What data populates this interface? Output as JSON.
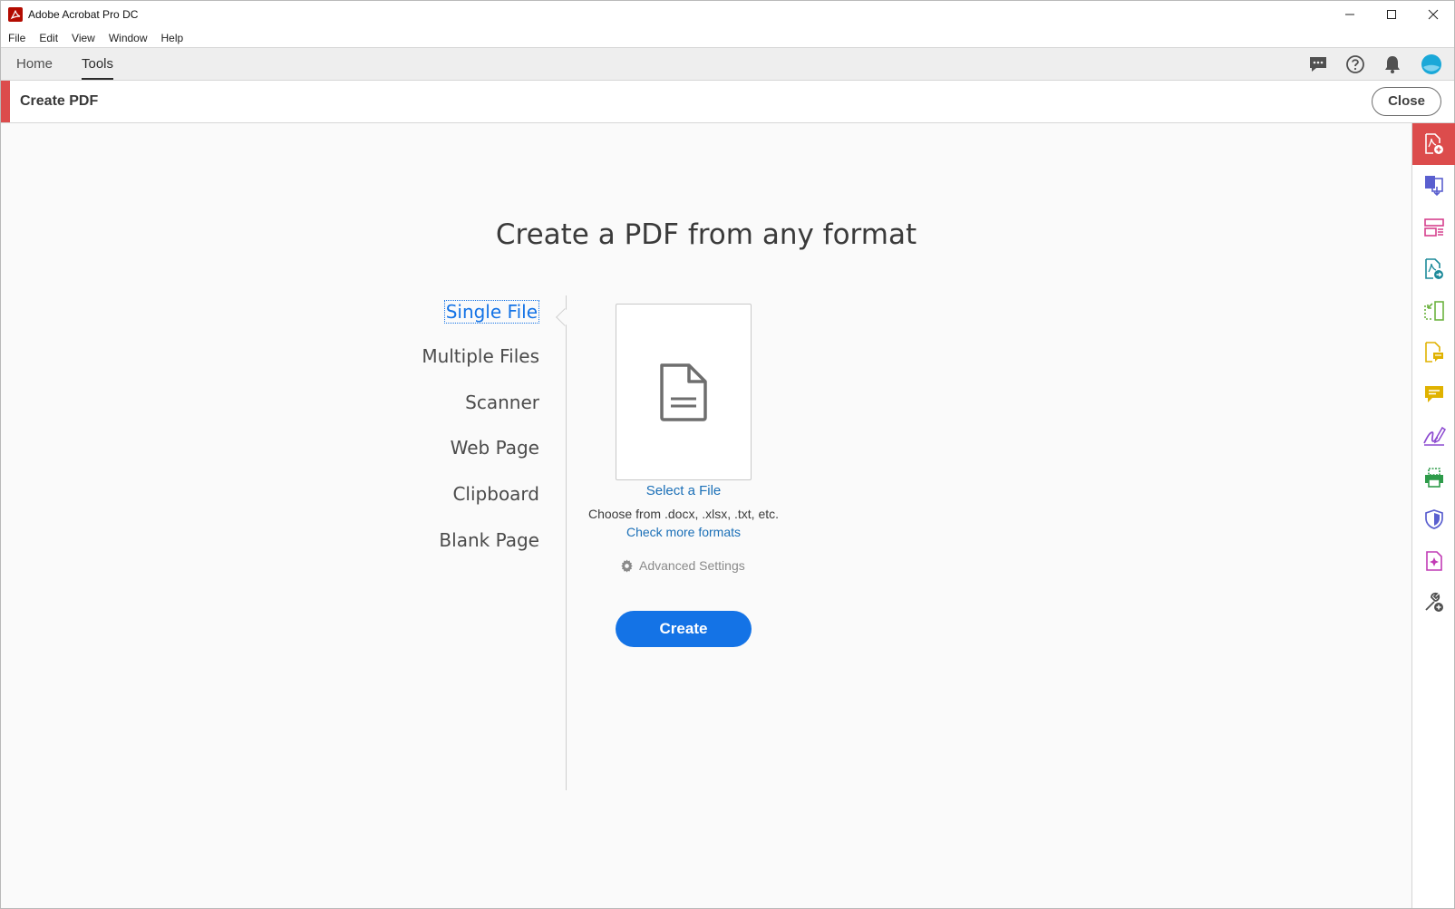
{
  "window": {
    "title": "Adobe Acrobat Pro DC",
    "controls": [
      "minimize-icon",
      "maximize-icon",
      "close-icon"
    ]
  },
  "menubar": {
    "items": [
      "File",
      "Edit",
      "View",
      "Window",
      "Help"
    ]
  },
  "tabs": {
    "items": [
      {
        "label": "Home",
        "active": false
      },
      {
        "label": "Tools",
        "active": true
      }
    ],
    "right_icons": [
      "chat-icon",
      "help-icon",
      "bell-icon",
      "avatar-icon"
    ]
  },
  "tool_header": {
    "title": "Create PDF",
    "close_label": "Close",
    "accent_color": "#dc4c4c"
  },
  "main": {
    "headline": "Create a PDF from any format",
    "options": [
      {
        "label": "Single File",
        "active": true
      },
      {
        "label": "Multiple Files",
        "active": false
      },
      {
        "label": "Scanner",
        "active": false
      },
      {
        "label": "Web Page",
        "active": false
      },
      {
        "label": "Clipboard",
        "active": false
      },
      {
        "label": "Blank Page",
        "active": false
      }
    ],
    "select_file_label": "Select a File",
    "choose_text": "Choose from .docx, .xlsx, .txt, etc.",
    "more_formats_label": "Check more formats",
    "advanced_settings_label": "Advanced Settings",
    "create_label": "Create",
    "create_color": "#1473e6"
  },
  "rail": {
    "items": [
      {
        "icon": "create-pdf-icon",
        "color": "#dc4c4c",
        "active": true
      },
      {
        "icon": "combine-files-icon",
        "color": "#5a5fcf",
        "active": false
      },
      {
        "icon": "organize-pages-icon",
        "color": "#d6408d",
        "active": false
      },
      {
        "icon": "export-pdf-icon",
        "color": "#1d8a9a",
        "active": false
      },
      {
        "icon": "edit-pdf-icon",
        "color": "#6cb33f",
        "active": false
      },
      {
        "icon": "comment-doc-icon",
        "color": "#e0b200",
        "active": false
      },
      {
        "icon": "comment-icon",
        "color": "#e0b200",
        "active": false
      },
      {
        "icon": "fill-sign-icon",
        "color": "#8c4ad0",
        "active": false
      },
      {
        "icon": "print-production-icon",
        "color": "#2e9b4a",
        "active": false
      },
      {
        "icon": "protect-icon",
        "color": "#5a5fcf",
        "active": false
      },
      {
        "icon": "rich-media-icon",
        "color": "#c13bb5",
        "active": false
      },
      {
        "icon": "more-tools-icon",
        "color": "#505050",
        "active": false
      }
    ]
  }
}
